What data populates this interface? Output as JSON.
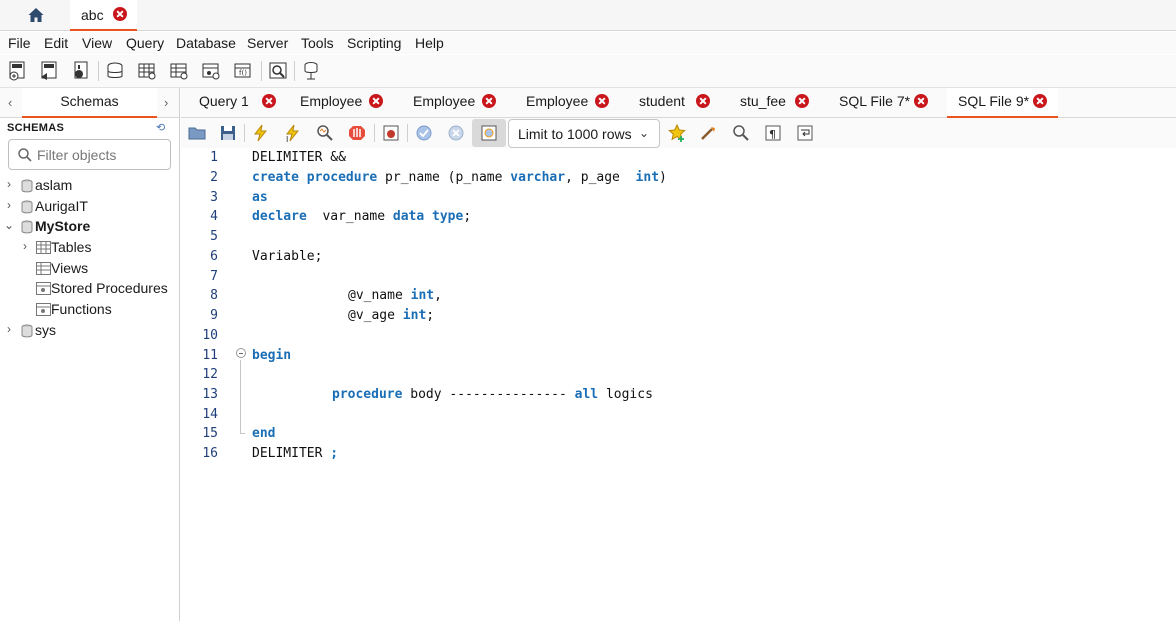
{
  "connection_tabs": {
    "home_icon": "home-icon",
    "active_tab": "abc"
  },
  "menu": [
    "File",
    "Edit",
    "View",
    "Query",
    "Database",
    "Server",
    "Tools",
    "Scripting",
    "Help"
  ],
  "sidebar": {
    "tab_label": "Schemas",
    "section_title": "SCHEMAS",
    "filter_placeholder": "Filter objects",
    "schemas": [
      "aslam",
      "AurigaIT",
      "MyStore",
      "sys"
    ],
    "mystore_children": [
      "Tables",
      "Views",
      "Stored Procedures",
      "Functions"
    ]
  },
  "editor_tabs": [
    "Query 1",
    "Employee",
    "Employee",
    "Employee",
    "student",
    "stu_fee",
    "SQL File 7*",
    "SQL File 9*"
  ],
  "active_editor_tab": "SQL File 9*",
  "editor_toolbar": {
    "limit_select": "Limit to 1000 rows"
  },
  "code": {
    "line_numbers": [
      "1",
      "2",
      "3",
      "4",
      "5",
      "6",
      "7",
      "8",
      "9",
      "10",
      "11",
      "12",
      "13",
      "14",
      "15",
      "16"
    ],
    "l1": "DELIMITER &&",
    "l2_kw1": "create procedure",
    "l2_t1": " pr_name (p_name ",
    "l2_kw2": "varchar",
    "l2_t2": ", p_age  ",
    "l2_kw3": "int",
    "l2_t3": ")",
    "l3_kw": "as",
    "l4_kw1": "declare",
    "l4_t1": "  var_name ",
    "l4_kw2": "data type",
    "l4_t2": ";",
    "l6": "Variable;",
    "l8_t": "@v_name ",
    "l8_kw": "int",
    "l8_t2": ",",
    "l9_t": "@v_age ",
    "l9_kw": "int",
    "l9_t2": ";",
    "l11_kw": "begin",
    "l13_kw1": "procedure",
    "l13_t1": " body --------------- ",
    "l13_kw2": "all",
    "l13_t2": " logics",
    "l15_kw": "end",
    "l16_t": "DELIMITER ",
    "l16_kw": ";"
  }
}
